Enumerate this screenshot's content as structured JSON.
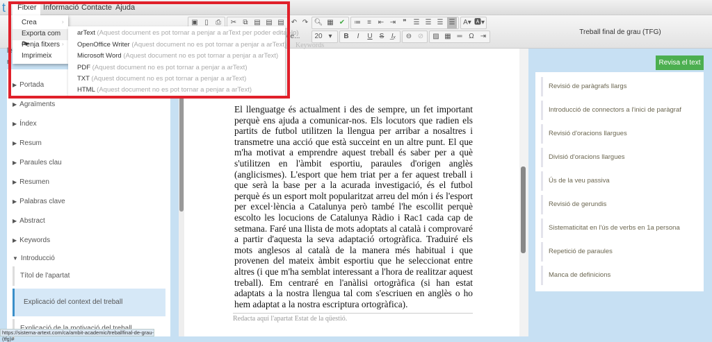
{
  "menubar": {
    "items": [
      "Fitxer",
      "Informació",
      "Contacte",
      "Ajuda"
    ]
  },
  "logo": "t",
  "document_title": "Treball final de grau (TFG)",
  "toolbar": {
    "font_name": "de...",
    "font_size": "20"
  },
  "file_menu": {
    "items": [
      "Crea",
      "Exporta com a",
      "Penja fitxers",
      "Imprimeix"
    ]
  },
  "export_submenu": [
    {
      "label": "arText",
      "note": "(Aquest document es pot tornar a penjar a arText per poder editar-lo)"
    },
    {
      "label": "OpenOffice Writer",
      "note": "(Aquest document no es pot tornar a penjar a arText)"
    },
    {
      "label": "Microsoft Word",
      "note": "(Aquest document no es pot tornar a penjar a arText)"
    },
    {
      "label": "PDF",
      "note": "(Aquest document no es pot tornar a penjar a arText)"
    },
    {
      "label": "TXT",
      "note": "(Aquest document no es pot tornar a penjar a arText)"
    },
    {
      "label": "HTML",
      "note": "(Aquest document no es pot tornar a penjar a arText)"
    }
  ],
  "left_peek": [
    "le",
    "n"
  ],
  "sections": [
    "Portada",
    "Agraïments",
    "Índex",
    "Resum",
    "Paraules clau",
    "Resumen",
    "Palabras clave",
    "Abstract",
    "Keywords",
    "Introducció"
  ],
  "subsections": [
    "Títol de l'apartat",
    "Explicació del context del treball",
    "Explicació de la motivació del treball"
  ],
  "editor": {
    "top_hint": "Keywords",
    "paragraph": "El llenguatge és actualment i des de sempre, un fet important perquè ens ajuda a comunicar-nos. Els locutors que radien els partits de futbol utilitzen la llengua per arribar a nosaltres i transmetre una acció que està succeint en un altre punt. El que m'ha motivat a emprendre aquest treball és saber per a què s'utilitzen en l'àmbit esportiu, paraules d'origen anglès (anglicismes). L'esport que hem triat per a fer aquest treball i que serà la base per a la acurada investigació, és el futbol perquè és un esport molt popularitzat arreu del món i és l'esport per excel·lència a Catalunya però també l'he escollit perquè escolto les locucions de Catalunya Ràdio i Rac1 cada cap de setmana. Faré una llista de mots adoptats al català i comprovaré a partir d'aquesta la seva adaptació ortogràfica. Traduiré els mots anglesos al català de la manera més habitual i que provenen del mateix àmbit esportiu que he seleccionat entre altres (i que m'ha semblat interessant a l'hora de realitzar aquest treball). Em centraré en l'anàlisi ortogràfica (si han estat adaptats a la nostra llengua tal com s'escriuen en anglès o ho hem adaptat a la nostra escriptura ortogràfica).",
    "next_placeholder": "Redacta aquí l'apartat Estat de la qüestió."
  },
  "review": {
    "button": "Revisa el text",
    "checks": [
      "Revisió de paràgrafs llargs",
      "Introducció de connectors a l'inici de paràgraf",
      "Revisió d'oracions llargues",
      "Divisió d'oracions llargues",
      "Ús de la veu passiva",
      "Revisió de gerundis",
      "Sistematicitat en l'ús de verbs en 1a persona",
      "Repetició de paraules",
      "Manca de definicions"
    ]
  },
  "status_url": "https://sistema-artext.com/ca/ambit-academic/treballfinal-de-grau-(tfg)#",
  "colors": {
    "accent_green": "#4caf50",
    "highlight_red": "#e0202a",
    "panel_blue": "#c7e0f3",
    "selected_blue": "#d6e8f7"
  }
}
